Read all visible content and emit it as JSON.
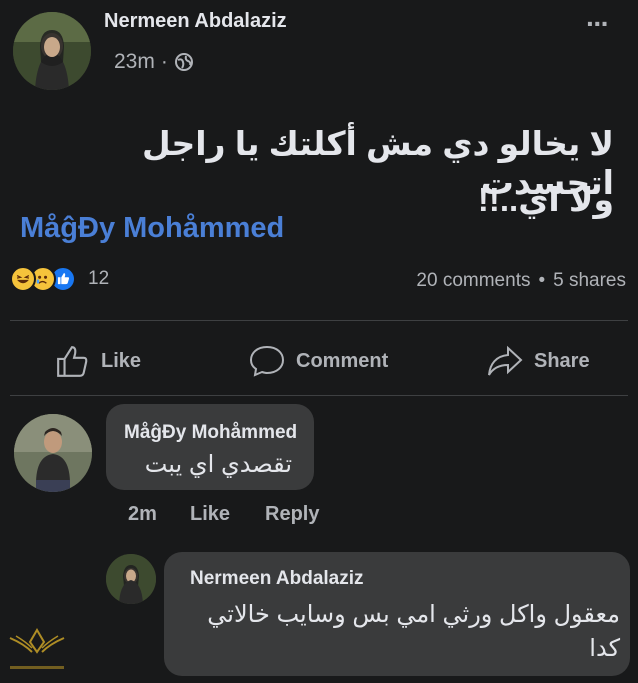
{
  "post": {
    "author": "Nermeen Abdalaziz",
    "time": "23m",
    "separator": "·",
    "more_label": "···",
    "text_line1": "لا يخالو دي مش أكلتك يا راجل اتحسدت",
    "text_line2": "ولا اي..!!",
    "mention": "MåĝĐy Mohåmmed",
    "reaction_count": "12",
    "comments_count": "20 comments",
    "shares_count": "5 shares",
    "dot": "•"
  },
  "actions": {
    "like": "Like",
    "comment": "Comment",
    "share": "Share"
  },
  "comments": [
    {
      "author": "MåĝĐy Mohåmmed",
      "text": "تقصدي اي يبت",
      "time": "2m",
      "like": "Like",
      "reply": "Reply"
    },
    {
      "author": "Nermeen Abdalaziz",
      "text_line1": "معقول واكل ورثي امي بس وسايب خالاتي",
      "text_line2": "كدا"
    }
  ],
  "colors": {
    "background": "#18191a",
    "bubble": "#3a3b3c",
    "mention": "#4a7fd6",
    "like_blue": "#1877f2"
  },
  "icons": [
    "globe-icon",
    "more-icon",
    "haha-reaction-icon",
    "sad-reaction-icon",
    "like-reaction-icon",
    "like-icon",
    "comment-icon",
    "share-icon",
    "watermark-logo"
  ]
}
